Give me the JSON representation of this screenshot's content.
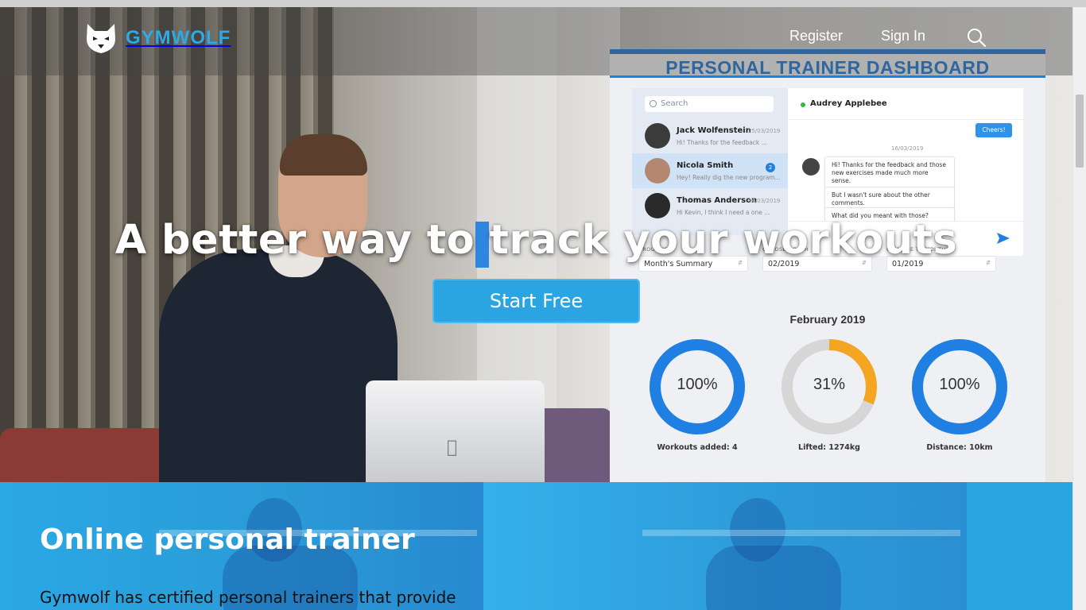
{
  "brand": {
    "name": "GYMWOLF",
    "color": "#2fa9e3"
  },
  "nav": {
    "register": "Register",
    "signin": "Sign In"
  },
  "hero": {
    "headline": "A better way to track your workouts",
    "cta": "Start Free"
  },
  "dashboard": {
    "title": "PERSONAL TRAINER DASHBOARD",
    "search_placeholder": "Search",
    "chats": [
      {
        "name": "Jack Wolfenstein",
        "date": "25/03/2019",
        "preview": "Hi! Thanks for the feedback ..."
      },
      {
        "name": "Nicola Smith",
        "badge": "2",
        "preview": "Hey! Really dig the new program..."
      },
      {
        "name": "Thomas Anderson",
        "date": "16/03/2019",
        "preview": "Hi Kevin, I think I need a one ..."
      }
    ],
    "conversation": {
      "contact": "Audrey Applebee",
      "date": "16/03/2019",
      "sent": "Cheers!",
      "messages": [
        "Hi! Thanks for the feedback and those new exercises made much more sense.",
        "But I wasn't sure about the other comments.",
        "What did you meant with those?"
      ]
    },
    "filters": [
      {
        "label": "GROUPING",
        "value": "Month's Summary"
      },
      {
        "label": "CHOOSE MONTH",
        "value": "02/2019"
      },
      {
        "label": "COMAPRE TO MONTH",
        "value": "01/2019"
      }
    ],
    "month_title": "February 2019",
    "stats": [
      {
        "value": "100%",
        "fraction": 1.0,
        "caption": "Workouts added: 4",
        "color": "#1f7fe2"
      },
      {
        "value": "31%",
        "fraction": 0.31,
        "caption": "Lifted: 1274kg",
        "color": "#f4a623"
      },
      {
        "value": "100%",
        "fraction": 1.0,
        "caption": "Distance: 10km",
        "color": "#1f7fe2"
      }
    ]
  },
  "section": {
    "title": "Online personal trainer",
    "text": "Gymwolf has certified personal trainers that provide"
  },
  "colors": {
    "accent": "#2ba4e2",
    "dashboard_blue": "#1f7fe2",
    "section_bg": "#2ba2df"
  }
}
